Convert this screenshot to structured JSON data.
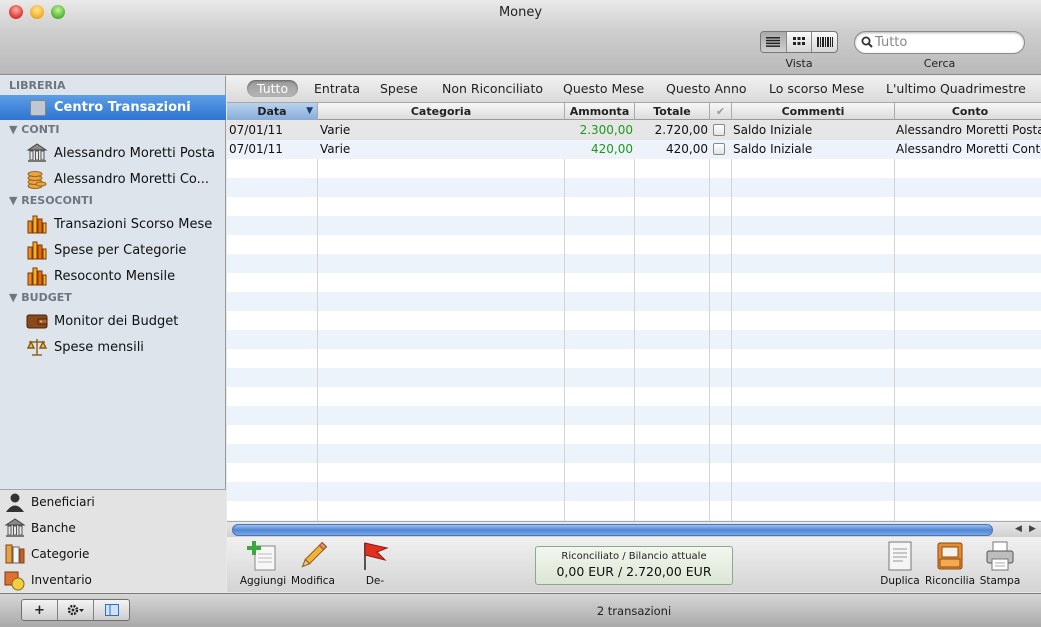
{
  "app": {
    "title": "Money"
  },
  "toolbar": {
    "view_label": "Vista",
    "search_label": "Cerca",
    "search_placeholder": "Tutto",
    "view_icons": [
      "list-view-icon",
      "grid-view-icon",
      "barcode-view-icon"
    ]
  },
  "sidebar": {
    "library_header": "LIBRERIA",
    "selected": "Centro Transazioni",
    "accounts_header": "CONTI",
    "accounts": [
      "Alessandro Moretti Posta",
      "Alessandro Moretti Co..."
    ],
    "reports_header": "RESOCONTI",
    "reports": [
      "Transazioni Scorso Mese",
      "Spese per Categorie",
      "Resoconto Mensile"
    ],
    "budget_header": "BUDGET",
    "budgets": [
      "Monitor dei Budget",
      "Spese mensili"
    ],
    "bottom": [
      "Beneficiari",
      "Banche",
      "Categorie",
      "Inventario"
    ]
  },
  "filters": [
    "Tutto",
    "Entrata",
    "Spese",
    "Non Riconciliato",
    "Questo Mese",
    "Questo Anno",
    "Lo scorso Mese",
    "L'ultimo Quadrimestre"
  ],
  "table": {
    "columns": [
      "Data",
      "Categoria",
      "Ammonta",
      "Totale",
      "",
      "Commenti",
      "Conto"
    ],
    "rows": [
      {
        "date": "07/01/11",
        "category": "Varie",
        "amount": "2.300,00",
        "total": "2.720,00",
        "checked": false,
        "comment": "Saldo Iniziale",
        "account": "Alessandro Moretti Posta"
      },
      {
        "date": "07/01/11",
        "category": "Varie",
        "amount": "420,00",
        "total": "420,00",
        "checked": false,
        "comment": "Saldo Iniziale",
        "account": "Alessandro Moretti Conto"
      }
    ]
  },
  "actions": {
    "add": "Aggiungi",
    "edit": "Modifica",
    "flag": "De-",
    "duplicate": "Duplica",
    "reconcile": "Riconcilia",
    "print": "Stampa"
  },
  "reconciled": {
    "label": "Riconciliato / Bilancio attuale",
    "value": "0,00 EUR / 2.720,00 EUR"
  },
  "status": {
    "text": "2 transazioni"
  },
  "colors": {
    "selection": "#3a7fd8",
    "positive": "#1c9a1c"
  }
}
